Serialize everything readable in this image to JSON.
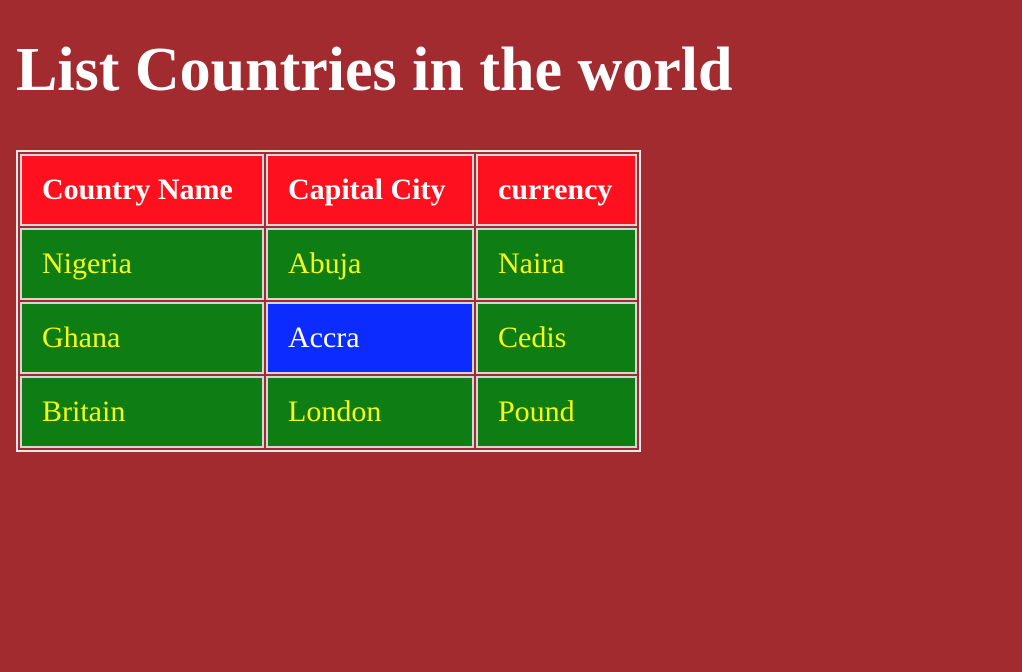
{
  "page": {
    "title": "List Countries in the world"
  },
  "table": {
    "headers": [
      "Country Name",
      "Capital City",
      "currency"
    ],
    "rows": [
      [
        "Nigeria",
        "Abuja",
        "Naira"
      ],
      [
        "Ghana",
        "Accra",
        "Cedis"
      ],
      [
        "Britain",
        "London",
        "Pound"
      ]
    ]
  },
  "colors": {
    "page_background": "#a12b2f",
    "header_background": "#ff101f",
    "header_text": "#ffffff",
    "cell_background": "#0e7d13",
    "cell_text": "#f7f71a",
    "highlight_background": "#0b2bff",
    "highlight_text": "#ffffff"
  }
}
